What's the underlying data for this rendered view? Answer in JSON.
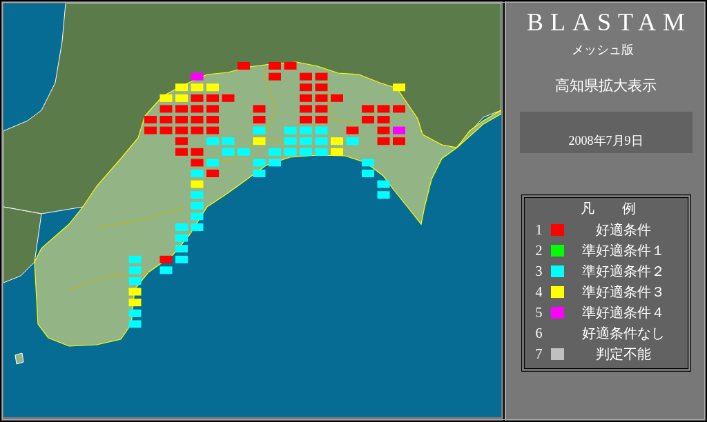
{
  "app": {
    "title": "BLASTAM",
    "subtitle": "メッシュ版",
    "view": "高知県拡大表示",
    "date": "2008年7月9日"
  },
  "legend": {
    "title": "凡　　例",
    "items": [
      {
        "number": "1",
        "label": "好適条件",
        "color": "#ff0000"
      },
      {
        "number": "2",
        "label": "準好適条件１",
        "color": "#00ff00"
      },
      {
        "number": "3",
        "label": "準好適条件２",
        "color": "#00ffff"
      },
      {
        "number": "4",
        "label": "準好適条件３",
        "color": "#ffff00"
      },
      {
        "number": "5",
        "label": "準好適条件４",
        "color": "#ff00ff"
      },
      {
        "number": "6",
        "label": "好適条件なし"
      },
      {
        "number": "7",
        "label": "判定不能",
        "color": "#c0c0c0"
      }
    ]
  }
}
